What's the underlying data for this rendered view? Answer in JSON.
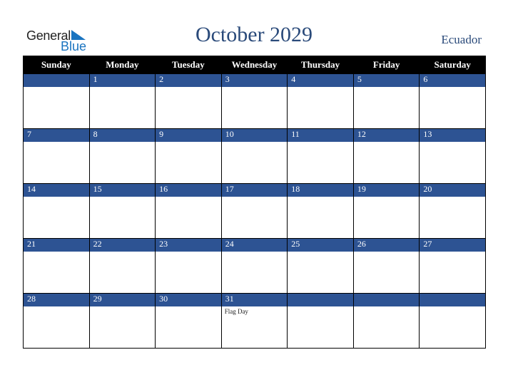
{
  "logo": {
    "line1": "General",
    "line2": "Blue"
  },
  "title": "October 2029",
  "country": "Ecuador",
  "weekdays": [
    "Sunday",
    "Monday",
    "Tuesday",
    "Wednesday",
    "Thursday",
    "Friday",
    "Saturday"
  ],
  "weeks": [
    [
      "",
      "1",
      "2",
      "3",
      "4",
      "5",
      "6"
    ],
    [
      "7",
      "8",
      "9",
      "10",
      "11",
      "12",
      "13"
    ],
    [
      "14",
      "15",
      "16",
      "17",
      "18",
      "19",
      "20"
    ],
    [
      "21",
      "22",
      "23",
      "24",
      "25",
      "26",
      "27"
    ],
    [
      "28",
      "29",
      "30",
      "31",
      "",
      "",
      ""
    ]
  ],
  "events": [
    [
      "",
      "",
      "",
      "",
      "",
      "",
      ""
    ],
    [
      "",
      "",
      "",
      "",
      "",
      "",
      ""
    ],
    [
      "",
      "",
      "",
      "",
      "",
      "",
      ""
    ],
    [
      "",
      "",
      "",
      "",
      "",
      "",
      ""
    ],
    [
      "",
      "",
      "",
      "Flag Day",
      "",
      "",
      ""
    ]
  ],
  "colors": {
    "header_bg": "#000000",
    "day_bar": "#2d5393",
    "title": "#2a4a7a",
    "logo_blue": "#1a74c0"
  }
}
